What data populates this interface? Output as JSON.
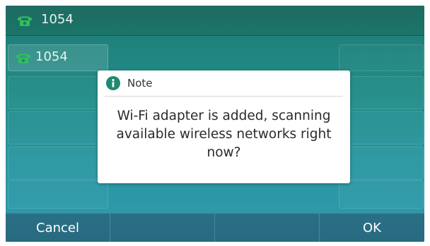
{
  "status_bar": {
    "line_label": "1054",
    "icon": "phone-icon"
  },
  "line_keys": [
    {
      "label": "1054",
      "icon": "phone-icon"
    }
  ],
  "dialog": {
    "title": "Note",
    "icon": "info-icon",
    "message": "Wi-Fi adapter is added, scanning available wireless networks right now?"
  },
  "softkeys": {
    "cancel": "Cancel",
    "ok": "OK"
  },
  "colors": {
    "phone_icon": "#2fc05a",
    "info_icon": "#1f8a72",
    "background_top": "#1f7a76",
    "background_bottom": "#2f9bb0"
  }
}
